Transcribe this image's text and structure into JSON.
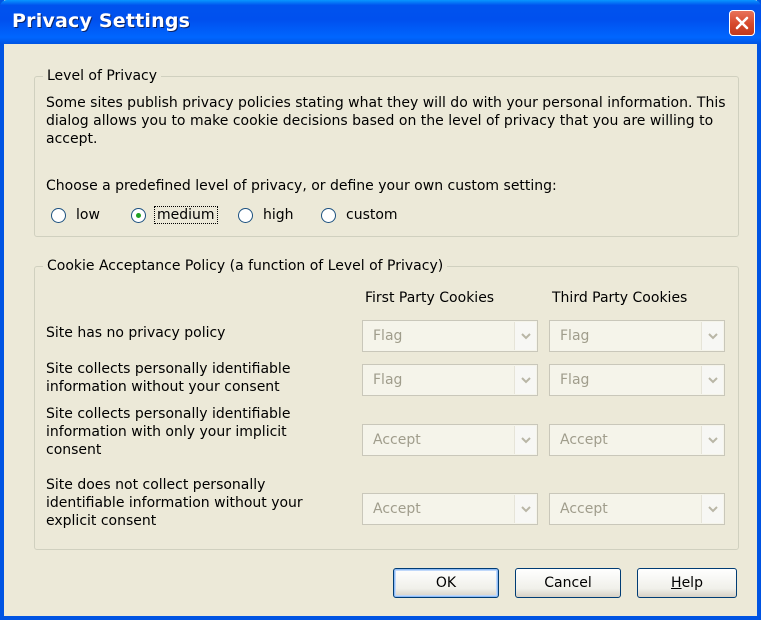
{
  "window": {
    "title": "Privacy Settings"
  },
  "level_group": {
    "legend": "Level of Privacy",
    "description": "Some sites publish privacy policies stating what they will do with your personal information. This dialog allows you to make cookie decisions based on the level of privacy that you are willing to accept.",
    "choose_text": "Choose a predefined level of privacy, or define your own custom setting:",
    "options": [
      {
        "label": "low",
        "selected": false
      },
      {
        "label": "medium",
        "selected": true
      },
      {
        "label": "high",
        "selected": false
      },
      {
        "label": "custom",
        "selected": false
      }
    ]
  },
  "policy_group": {
    "legend": "Cookie Acceptance Policy (a function of Level of Privacy)",
    "columns": {
      "first": "First Party Cookies",
      "third": "Third Party Cookies"
    },
    "rows": [
      {
        "label_lines": [
          "Site has no privacy policy"
        ],
        "first": "Flag",
        "third": "Flag"
      },
      {
        "label_lines": [
          "Site collects personally identifiable",
          "information without your consent"
        ],
        "first": "Flag",
        "third": "Flag"
      },
      {
        "label_lines": [
          "Site collects personally identifiable",
          "information with only your implicit",
          "consent"
        ],
        "first": "Accept",
        "third": "Accept"
      },
      {
        "label_lines": [
          "Site does not collect personally",
          "identifiable information without your",
          "explicit consent"
        ],
        "first": "Accept",
        "third": "Accept"
      }
    ]
  },
  "buttons": {
    "ok": "OK",
    "cancel": "Cancel",
    "help_prefix": "H",
    "help_rest": "elp"
  },
  "colors": {
    "titlebar": "#0054e3",
    "dialog_bg": "#ece9d8",
    "close": "#d6492c",
    "radio_dot": "#21a121",
    "disabled_text": "#a09d8c"
  },
  "icons": {
    "close": "close-x-icon",
    "dropdown": "chevron-down-icon"
  }
}
